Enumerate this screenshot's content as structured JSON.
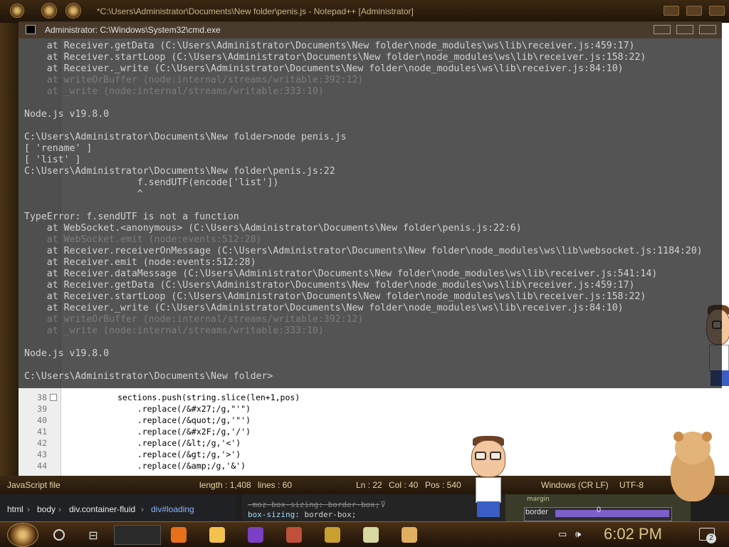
{
  "notepad": {
    "title": "*C:\\Users\\Administrator\\Documents\\New folder\\penis.js - Notepad++ [Administrator]",
    "code": [
      {
        "num": "38",
        "text": "            sections.push(string.slice(len+1,pos)"
      },
      {
        "num": "39",
        "text": "                .replace(/&#x27;/g,\"'\")"
      },
      {
        "num": "40",
        "text": "                .replace(/&quot;/g,'\"')"
      },
      {
        "num": "41",
        "text": "                .replace(/&#x2F;/g,'/')"
      },
      {
        "num": "42",
        "text": "                .replace(/&lt;/g,'<')"
      },
      {
        "num": "43",
        "text": "                .replace(/&gt;/g,'>')"
      },
      {
        "num": "44",
        "text": "                .replace(/&amp;/g,'&')"
      }
    ],
    "status": {
      "language": "JavaScript file",
      "length": "length : 1,408",
      "lines": "lines : 60",
      "ln": "Ln : 22",
      "col": "Col : 40",
      "pos": "Pos : 540",
      "eol": "Windows (CR LF)",
      "encoding": "UTF-8"
    }
  },
  "cmd": {
    "title": "Administrator: C:\\Windows\\System32\\cmd.exe",
    "lines": [
      "    at Receiver.getData (C:\\Users\\Administrator\\Documents\\New folder\\node_modules\\ws\\lib\\receiver.js:459:17)",
      "    at Receiver.startLoop (C:\\Users\\Administrator\\Documents\\New folder\\node_modules\\ws\\lib\\receiver.js:158:22)",
      "    at Receiver._write (C:\\Users\\Administrator\\Documents\\New folder\\node_modules\\ws\\lib\\receiver.js:84:10)",
      "    at writeOrBuffer (node:internal/streams/writable:392:12)",
      "    at _write (node:internal/streams/writable:333:10)",
      "",
      "Node.js v19.8.0",
      "",
      "C:\\Users\\Administrator\\Documents\\New folder>node penis.js",
      "[ 'rename' ]",
      "[ 'list' ]",
      "C:\\Users\\Administrator\\Documents\\New folder\\penis.js:22",
      "                    f.sendUTF(encode['list'])",
      "                    ^",
      "",
      "TypeError: f.sendUTF is not a function",
      "    at WebSocket.<anonymous> (C:\\Users\\Administrator\\Documents\\New folder\\penis.js:22:6)",
      "    at WebSocket.emit (node:events:512:28)",
      "    at Receiver.receiverOnMessage (C:\\Users\\Administrator\\Documents\\New folder\\node_modules\\ws\\lib\\websocket.js:1184:20)",
      "    at Receiver.emit (node:events:512:28)",
      "    at Receiver.dataMessage (C:\\Users\\Administrator\\Documents\\New folder\\node_modules\\ws\\lib\\receiver.js:541:14)",
      "    at Receiver.getData (C:\\Users\\Administrator\\Documents\\New folder\\node_modules\\ws\\lib\\receiver.js:459:17)",
      "    at Receiver.startLoop (C:\\Users\\Administrator\\Documents\\New folder\\node_modules\\ws\\lib\\receiver.js:158:22)",
      "    at Receiver._write (C:\\Users\\Administrator\\Documents\\New folder\\node_modules\\ws\\lib\\receiver.js:84:10)",
      "    at writeOrBuffer (node:internal/streams/writable:392:12)",
      "    at _write (node:internal/streams/writable:333:10)",
      "",
      "Node.js v19.8.0",
      "",
      "C:\\Users\\Administrator\\Documents\\New folder>"
    ]
  },
  "devtools": {
    "breadcrumbs": [
      "html",
      "body",
      "div.container-fluid",
      "div#loading"
    ],
    "styles": {
      "struck": "-moz-box-sizing: border-box;",
      "active_prop": "box-sizing",
      "active_value": "border-box;"
    },
    "boxmodel": {
      "margin_label": "margin",
      "border_label": "border",
      "border_value": "0"
    }
  },
  "taskbar": {
    "clock": "6:02 PM",
    "notification_count": "2",
    "apps": [
      {
        "name": "firefox-icon",
        "color": "#e8701a"
      },
      {
        "name": "file-explorer-icon",
        "color": "#f2c14e"
      },
      {
        "name": "visual-studio-icon",
        "color": "#7a3fc4"
      },
      {
        "name": "game-icon",
        "color": "#c0503a"
      },
      {
        "name": "bros-game-icon",
        "color": "#c9a030"
      },
      {
        "name": "chart-app-icon",
        "color": "#d8d8a0"
      },
      {
        "name": "media-app-icon",
        "color": "#e0b060"
      }
    ]
  }
}
